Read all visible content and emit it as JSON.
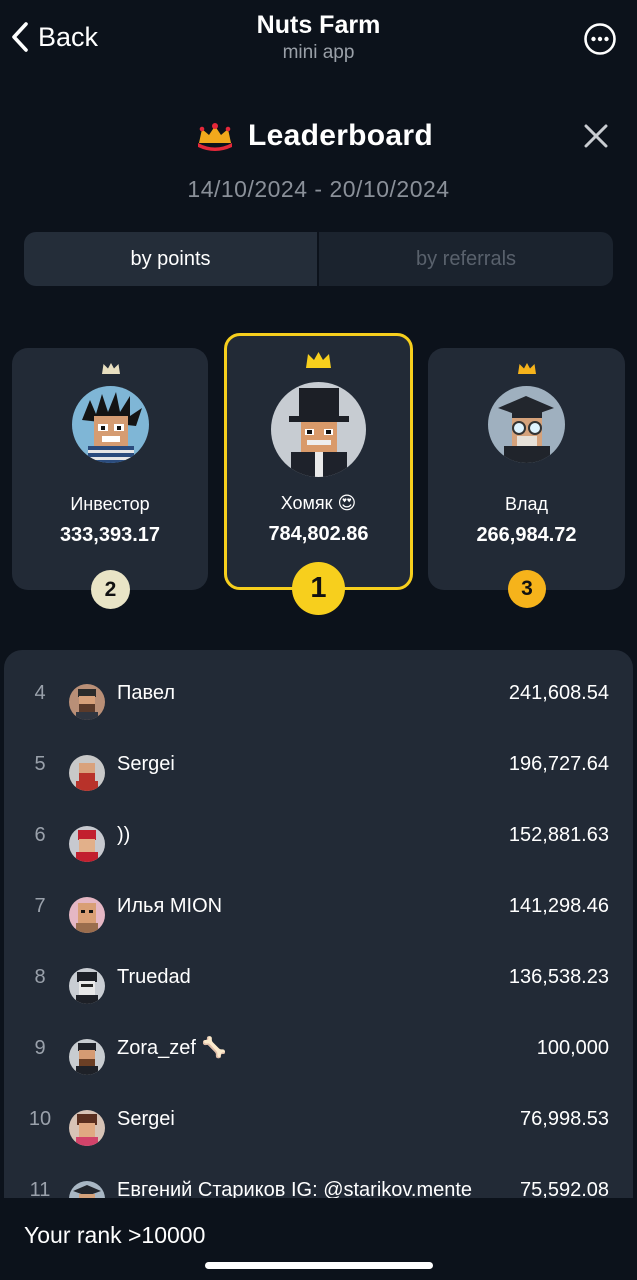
{
  "header": {
    "back_label": "Back",
    "app_title": "Nuts Farm",
    "app_subtitle": "mini app",
    "back_icon": "chevron-left-icon",
    "more_icon": "more-horizontal-circle-icon"
  },
  "leaderboard": {
    "title": "Leaderboard",
    "title_icon": "crown-logo-icon",
    "close_icon": "close-icon",
    "date_range": "14/10/2024 - 20/10/2024"
  },
  "tabs": [
    {
      "label": "by points",
      "active": true
    },
    {
      "label": "by referrals",
      "active": false
    }
  ],
  "podium": {
    "first": {
      "rank": "1",
      "name": "Хомяк 😍",
      "score": "784,802.86"
    },
    "second": {
      "rank": "2",
      "name": "Инвестор",
      "score": "333,393.17"
    },
    "third": {
      "rank": "3",
      "name": "Влад",
      "score": "266,984.72"
    }
  },
  "list": [
    {
      "rank": "4",
      "name": "Павел",
      "score": "241,608.54"
    },
    {
      "rank": "5",
      "name": "Sergei",
      "score": "196,727.64"
    },
    {
      "rank": "6",
      "name": "))",
      "score": "152,881.63"
    },
    {
      "rank": "7",
      "name": "Илья MION",
      "score": "141,298.46"
    },
    {
      "rank": "8",
      "name": "Truedad",
      "score": "136,538.23"
    },
    {
      "rank": "9",
      "name": "Zora_zef 🦴",
      "score": "100,000"
    },
    {
      "rank": "10",
      "name": "Sergei",
      "score": "76,998.53"
    },
    {
      "rank": "11",
      "name": "Евгений Стариков IG: @starikov.mente",
      "score": "75,592.08"
    }
  ],
  "footer": {
    "your_rank": "Your rank >10000"
  },
  "colors": {
    "background": "#0c121b",
    "card": "#222a36",
    "accent_gold": "#f7cf1d",
    "silver_badge": "#e9e4c6",
    "bronze_badge": "#f6b31b"
  }
}
